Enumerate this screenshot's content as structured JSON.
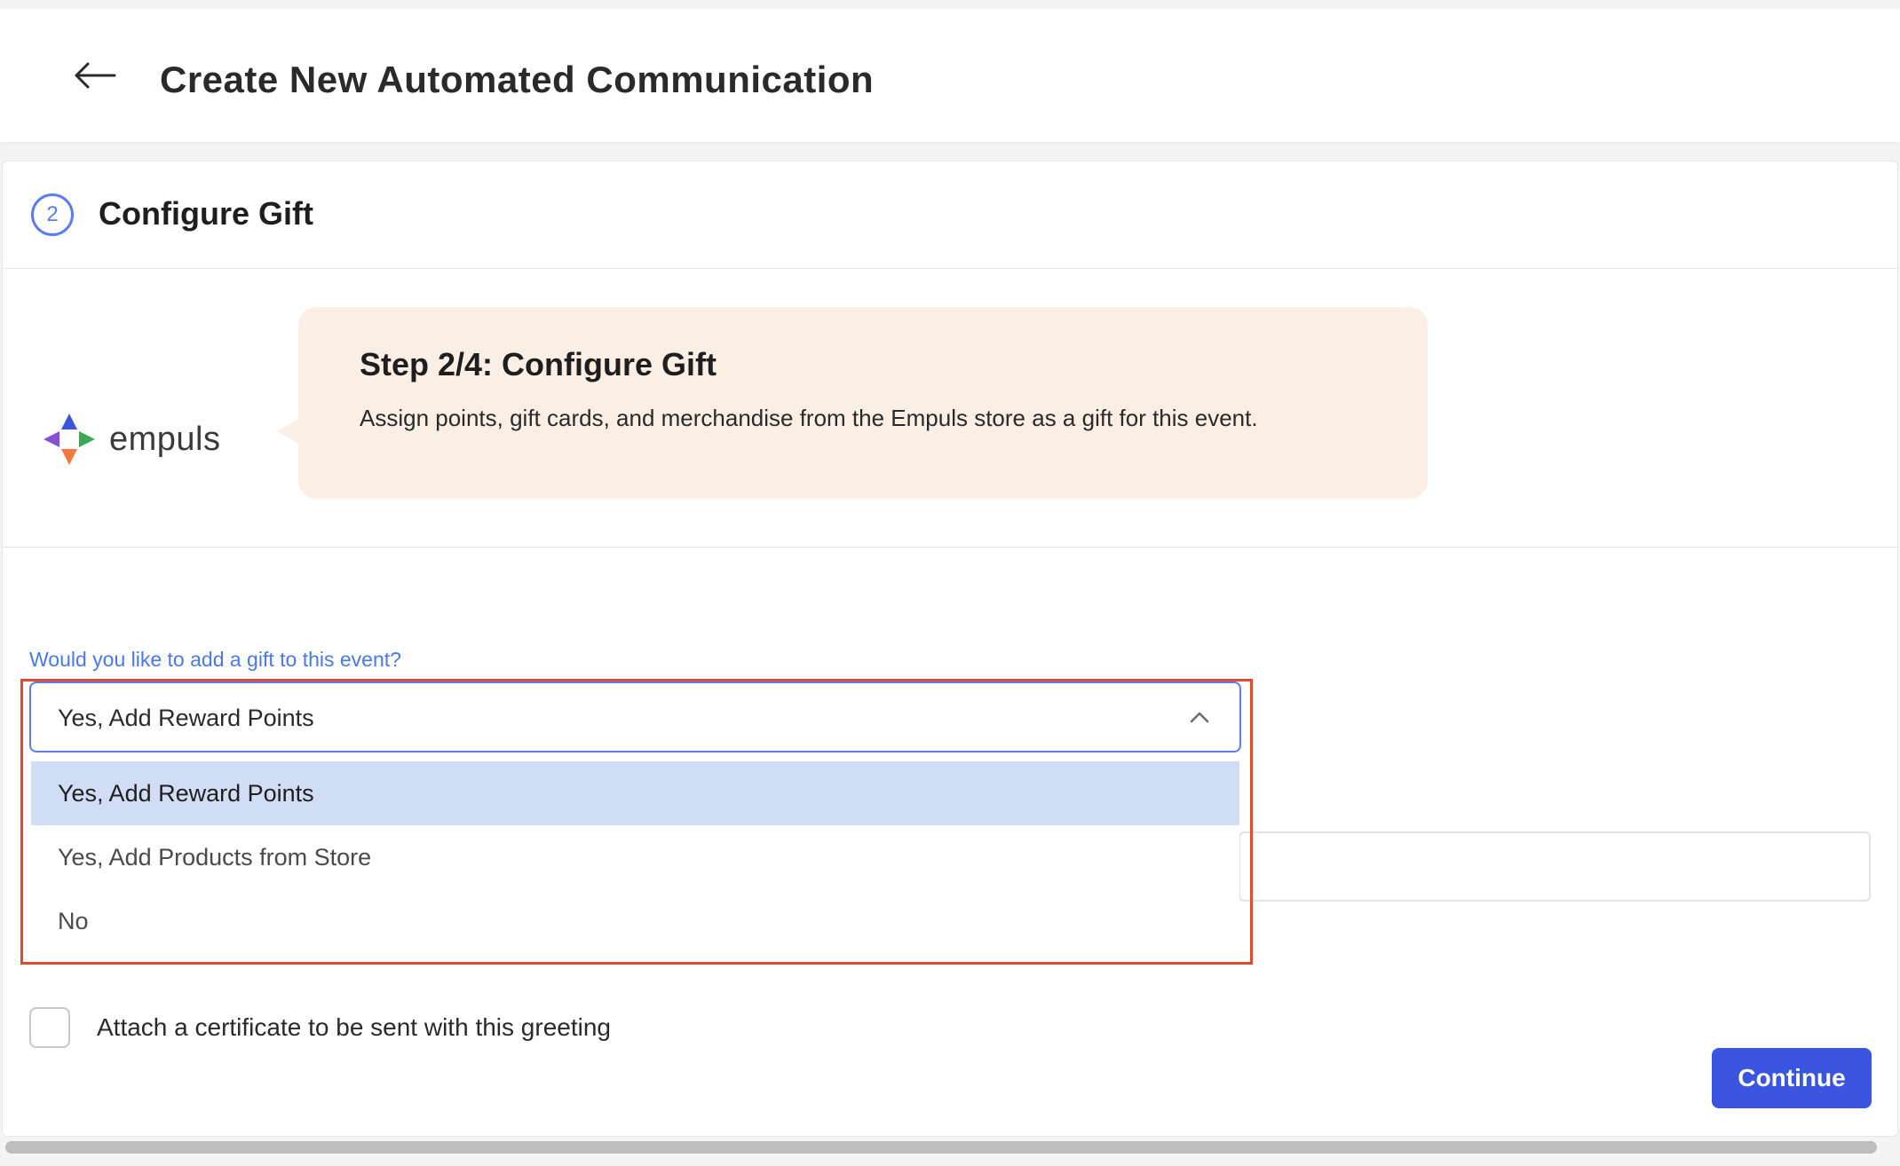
{
  "header": {
    "title": "Create New Automated Communication",
    "back_icon": "arrow-left-icon"
  },
  "step": {
    "number": "2",
    "title": "Configure Gift"
  },
  "intro": {
    "logo_text": "empuls",
    "bubble_title": "Step 2/4: Configure Gift",
    "bubble_text": "Assign points, gift cards, and merchandise from the Empuls store as a gift for this event."
  },
  "gift": {
    "question": "Would you like to add a gift to this event?",
    "selected_value": "Yes, Add Reward Points",
    "options": [
      "Yes, Add Reward Points",
      "Yes, Add Products from Store",
      "No"
    ]
  },
  "certificate": {
    "label": "Attach a certificate to be sent with this greeting",
    "checked": false
  },
  "actions": {
    "continue_label": "Continue"
  },
  "colors": {
    "accent": "#3a56e0",
    "highlight": "#e04a2f",
    "bubble": "#fbeee4",
    "selected_option": "#d0ddf4",
    "label_blue": "#4a79e6"
  }
}
